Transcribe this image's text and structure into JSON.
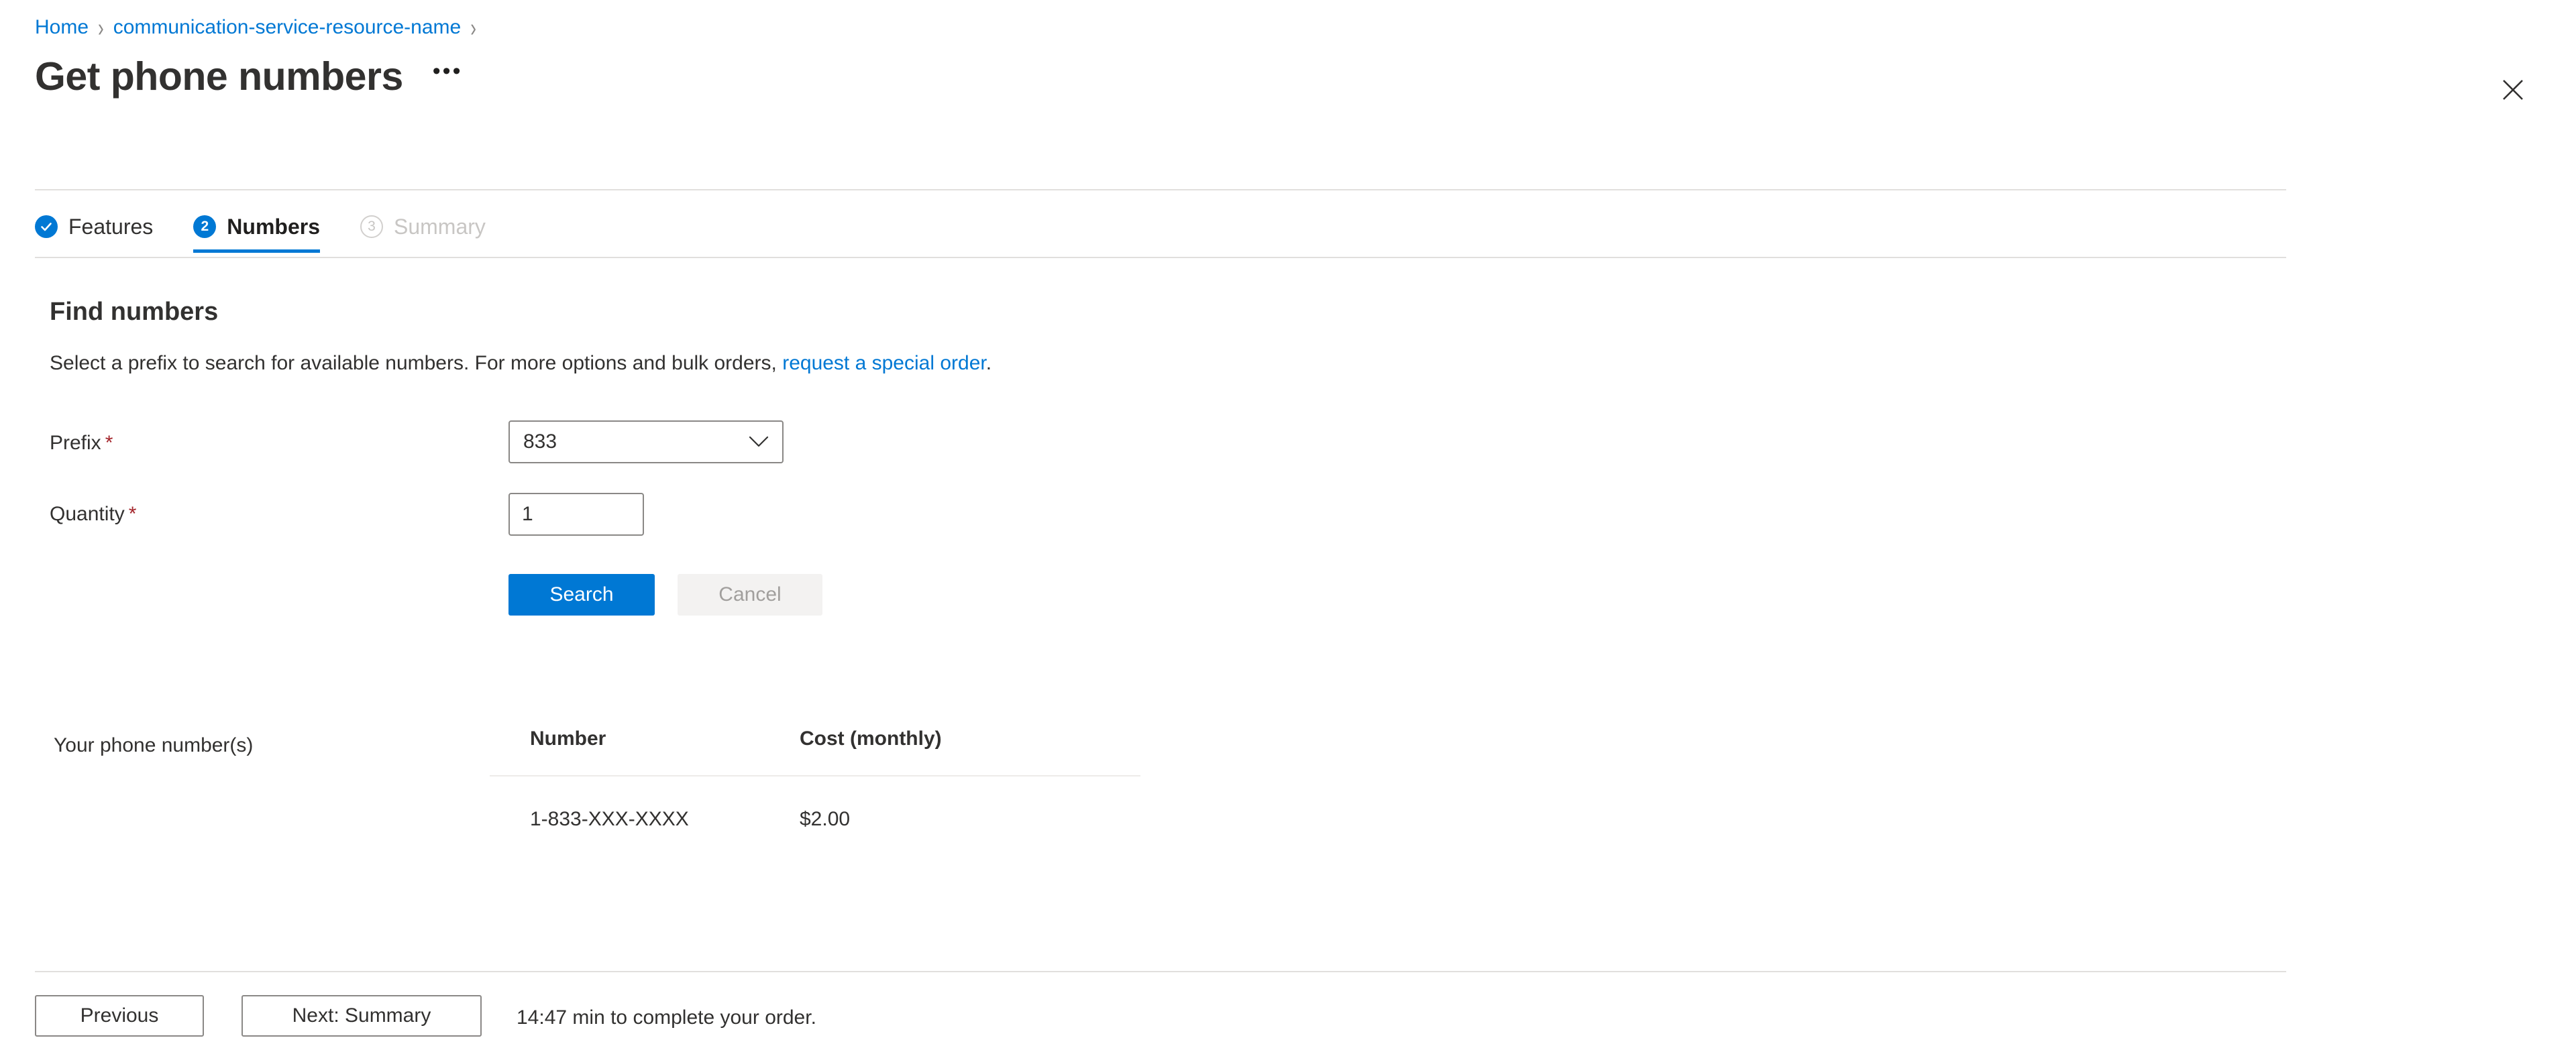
{
  "breadcrumb": {
    "items": [
      {
        "label": "Home"
      },
      {
        "label": "communication-service-resource-name"
      }
    ],
    "separator": "›"
  },
  "header": {
    "title": "Get phone numbers",
    "ellipsis_label": "•••",
    "close_icon": "close-icon"
  },
  "wizard": {
    "tabs": [
      {
        "label": "Features",
        "badge": "✓",
        "state": "done"
      },
      {
        "label": "Numbers",
        "badge": "2",
        "state": "current"
      },
      {
        "label": "Summary",
        "badge": "3",
        "state": "disabled"
      }
    ]
  },
  "section": {
    "heading": "Find numbers",
    "description_before": "Select a prefix to search for available numbers. For more options and bulk orders, ",
    "link_text": "request a special order",
    "description_after": "."
  },
  "form": {
    "prefix": {
      "label": "Prefix",
      "required_marker": "*",
      "value": "833",
      "chevron_icon": "chevron-down-icon"
    },
    "quantity": {
      "label": "Quantity",
      "required_marker": "*",
      "value": "1",
      "placeholder": ""
    },
    "search_label": "Search",
    "cancel_label": "Cancel"
  },
  "results": {
    "label": "Your phone number(s)",
    "columns": [
      "Number",
      "Cost (monthly)"
    ],
    "rows": [
      {
        "number": "1-833-XXX-XXXX",
        "cost": "$2.00"
      }
    ]
  },
  "footer": {
    "previous_label": "Previous",
    "next_label": "Next: Summary",
    "timer_text": "14:47 min to complete your order."
  },
  "colors": {
    "accent": "#0078d4",
    "link": "#0078d4",
    "required": "#a4262c",
    "text": "#323130",
    "disabled_text": "#c8c6c4",
    "border": "#8a8886",
    "rule": "#e1dfdd"
  }
}
